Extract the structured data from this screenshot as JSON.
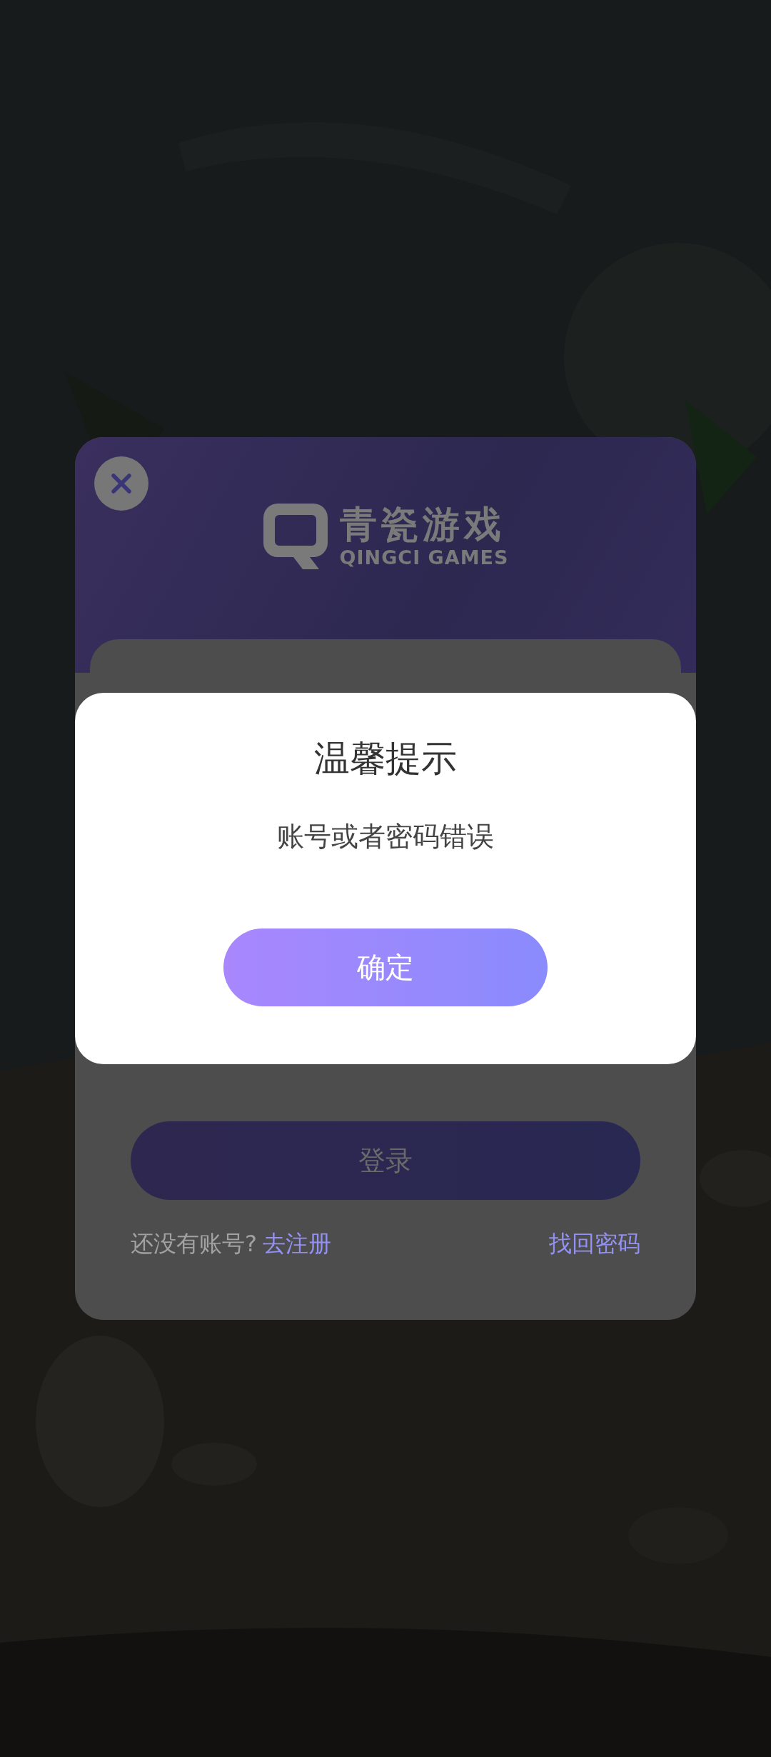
{
  "login_card": {
    "logo": {
      "name": "青瓷游戏",
      "subtitle": "QINGCI GAMES"
    },
    "login_button": "登录",
    "register_prompt": "还没有账号?",
    "register_link": "去注册",
    "recover_link": "找回密码"
  },
  "dialog": {
    "title": "温馨提示",
    "message": "账号或者密码错误",
    "confirm_button": "确定"
  }
}
